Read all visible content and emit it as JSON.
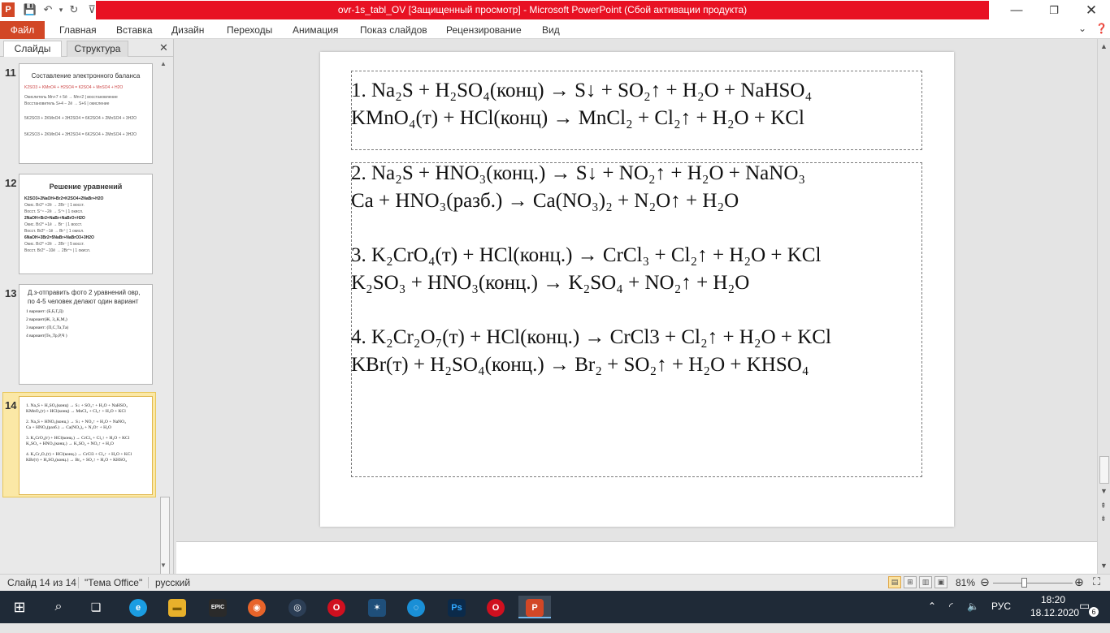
{
  "window": {
    "title": "ovr-1s_tabl_OV [Защищенный просмотр] -  Microsoft PowerPoint (Сбой активации продукта)",
    "app_letter": "P"
  },
  "ribbon": {
    "tabs": [
      "Файл",
      "Главная",
      "Вставка",
      "Дизайн",
      "Переходы",
      "Анимация",
      "Показ слайдов",
      "Рецензирование",
      "Вид"
    ]
  },
  "pane": {
    "tabs": [
      "Слайды",
      "Структура"
    ],
    "close": "✕"
  },
  "slides": [
    {
      "number": "11",
      "title": "Составление электронного баланса",
      "lines": [
        {
          "text": "K2SO3 + KMnO4 + H2SO4 = K2SO4 + MnSO4 + H2O",
          "style": "red"
        },
        {
          "text": "Окислитель  Mn+7 + 5ē → Mn+2 | восстановление",
          "style": ""
        },
        {
          "text": "Восстановитель  S+4 − 2ē → S+6 | окисление",
          "style": ""
        },
        {
          "text": "5K2SO3 + 2KMnO4 + 3H2SO4 = 6K2SO4 + 2MnSO4 + 3H2O",
          "style": ""
        },
        {
          "text": "5K2SO3 + 2KMnO4 + 3H2SO4 = 6K2SO4 + 2MnSO4 + 3H2O",
          "style": ""
        }
      ]
    },
    {
      "number": "12",
      "title": "Решение уравнений",
      "lines": [
        {
          "text": "K2SO3+2NaOH+Br2=K2SO4+2NaBr+H2O",
          "style": "b"
        },
        {
          "text": "Окис. Br2⁰ +2ē → 2Br⁻ | 1 восст.",
          "style": ""
        },
        {
          "text": "Восст. S⁺⁴ −2ē → S⁺⁶ | 1 окисл.",
          "style": ""
        },
        {
          "text": "2NaOH+Br2=NaBr+NaBrO+H2O",
          "style": "b"
        },
        {
          "text": "Окис. Br2⁰ +1ē → Br⁻ | 1 восст.",
          "style": ""
        },
        {
          "text": "Восст. Br2⁰ −1ē → Br⁺ | 1 окисл.",
          "style": ""
        },
        {
          "text": "6NaOH+3Br2=5NaBr+NaBrO3+3H2O",
          "style": "b"
        },
        {
          "text": "Окис. Br2⁰ +2ē → 2Br⁻ | 5 восст.",
          "style": ""
        },
        {
          "text": "Восст. Br2⁰ −10ē → 2Br⁺⁵ | 1 окисл.",
          "style": ""
        }
      ]
    },
    {
      "number": "13",
      "title": "Д.з-отправить фото 2 уравнений овр, по 4-5 человек делают один вариант",
      "lines": [
        {
          "text": "1 вариант: (Б,Б,Г,Д)",
          "style": ""
        },
        {
          "text": "2 вариант(Ж, З,,К,М,)",
          "style": ""
        },
        {
          "text": "3 вариант: (П,С,Та,Та)",
          "style": ""
        },
        {
          "text": "4 вариант(Те,,Тр,Р,Ч )",
          "style": ""
        }
      ]
    },
    {
      "number": "14",
      "title": "",
      "lines": [
        {
          "text": "1. Na₂S + H₂SO₄(конц) → S↓ + SO₂↑ + H₂O + NaHSO₄",
          "style": ""
        },
        {
          "text": "KMnO₄(т) + HCl(конц) → MnCl₂ + Cl₂↑ + H₂O + KCl",
          "style": ""
        },
        {
          "text": "2. Na₂S + HNO₃(конц.) → S↓ + NO₂↑ + H₂O + NaNO₃",
          "style": ""
        },
        {
          "text": "Ca + HNO₃(разб.) → Ca(NO₃)₂ + N₂O↑ + H₂O",
          "style": ""
        },
        {
          "text": "3. K₂CrO₄(т) + HCl(конц.) → CrCl₃ + Cl₂↑ + H₂O + KCl",
          "style": ""
        },
        {
          "text": "K₂SO₃ + HNO₃(конц.) → K₂SO₄ + NO₂↑ + H₂O",
          "style": ""
        },
        {
          "text": "4. K₂Cr₂O₇(т) + HCl(конц.) → CrCl3 + Cl₂↑ + H₂O + KCl",
          "style": ""
        },
        {
          "text": "KBr(т) + H₂SO₄(конц.) → Br₂ + SO₂↑ + H₂O + KHSO₄",
          "style": ""
        }
      ]
    }
  ],
  "current_slide": {
    "equations": [
      "1. Na₂S + H₂SO₄(конц) → S↓ + SO₂↑ + H₂O + NaHSO₄",
      "KMnO₄(т) + HCl(конц) → MnCl₂ + Cl₂↑ + H₂O + KCl",
      "2. Na₂S + HNO₃(конц.) → S↓ + NO₂↑ + H₂O + NaNO₃",
      "Ca + HNO₃(разб.) → Ca(NO₃)₂ + N₂O↑ + H₂O",
      "3. K₂CrO₄(т) + HCl(конц.) → CrCl₃ + Cl₂↑ + H₂O + KCl",
      "K₂SO₃ + HNO₃(конц.) → K₂SO₄ + NO₂↑ + H₂O",
      "4. K₂Cr₂O₇(т) + HCl(конц.) → CrCl3 + Cl₂↑ + H₂O + KCl",
      "KBr(т) + H₂SO₄(конц.) → Br₂ + SO₂↑ + H₂O + KHSO₄"
    ]
  },
  "status": {
    "slide_info": "Слайд 14 из 14",
    "theme": "\"Тема Office\"",
    "language": "русский",
    "zoom": "81%"
  },
  "taskbar": {
    "apps": [
      {
        "name": "edge",
        "label": "e"
      },
      {
        "name": "explorer",
        "label": "▬"
      },
      {
        "name": "epic-games",
        "label": "EPIC"
      },
      {
        "name": "firefox",
        "label": "◉"
      },
      {
        "name": "steam",
        "label": "◎"
      },
      {
        "name": "opera",
        "label": "O"
      },
      {
        "name": "app-blue",
        "label": "✶"
      },
      {
        "name": "uplay",
        "label": "◌"
      },
      {
        "name": "photoshop",
        "label": "Ps"
      },
      {
        "name": "opera-2",
        "label": "O"
      },
      {
        "name": "powerpoint",
        "label": "P"
      }
    ],
    "language": "РУС",
    "time": "18:20",
    "date": "18.12.2020",
    "notifications": "6"
  },
  "colors": {
    "title_band": "#e81123",
    "file_tab": "#d24726",
    "selected_thumb": "#fbe8a6",
    "taskbar": "#1f2a37"
  }
}
